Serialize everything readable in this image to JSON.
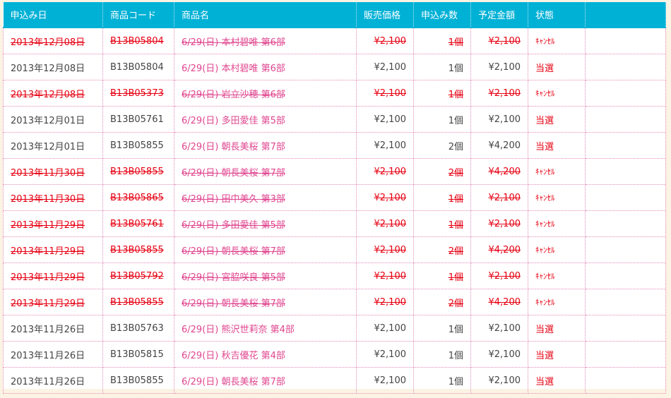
{
  "columns": {
    "date": "申込み日",
    "code": "商品コード",
    "name": "商品名",
    "price": "販売価格",
    "qty": "申込み数",
    "amount": "予定金額",
    "status": "状態"
  },
  "rows": [
    {
      "date": "2013年12月08日",
      "code": "B13B05804",
      "name": "6/29(日) 本村碧唯 第6部",
      "price": "¥2,100",
      "qty": "1個",
      "amount": "¥2,100",
      "status": "ｷｬﾝｾﾙ",
      "cancelled": true
    },
    {
      "date": "2013年12月08日",
      "code": "B13B05804",
      "name": "6/29(日) 本村碧唯 第6部",
      "price": "¥2,100",
      "qty": "1個",
      "amount": "¥2,100",
      "status": "当選",
      "cancelled": false
    },
    {
      "date": "2013年12月08日",
      "code": "B13B05373",
      "name": "6/29(日) 岩立沙穂 第6部",
      "price": "¥2,100",
      "qty": "1個",
      "amount": "¥2,100",
      "status": "ｷｬﾝｾﾙ",
      "cancelled": true
    },
    {
      "date": "2013年12月01日",
      "code": "B13B05761",
      "name": "6/29(日) 多田愛佳 第5部",
      "price": "¥2,100",
      "qty": "1個",
      "amount": "¥2,100",
      "status": "当選",
      "cancelled": false
    },
    {
      "date": "2013年12月01日",
      "code": "B13B05855",
      "name": "6/29(日) 朝長美桜 第7部",
      "price": "¥2,100",
      "qty": "2個",
      "amount": "¥4,200",
      "status": "当選",
      "cancelled": false
    },
    {
      "date": "2013年11月30日",
      "code": "B13B05855",
      "name": "6/29(日) 朝長美桜 第7部",
      "price": "¥2,100",
      "qty": "2個",
      "amount": "¥4,200",
      "status": "ｷｬﾝｾﾙ",
      "cancelled": true
    },
    {
      "date": "2013年11月30日",
      "code": "B13B05865",
      "name": "6/29(日) 田中美久 第3部",
      "price": "¥2,100",
      "qty": "1個",
      "amount": "¥2,100",
      "status": "ｷｬﾝｾﾙ",
      "cancelled": true
    },
    {
      "date": "2013年11月29日",
      "code": "B13B05761",
      "name": "6/29(日) 多田愛佳 第5部",
      "price": "¥2,100",
      "qty": "1個",
      "amount": "¥2,100",
      "status": "ｷｬﾝｾﾙ",
      "cancelled": true
    },
    {
      "date": "2013年11月29日",
      "code": "B13B05855",
      "name": "6/29(日) 朝長美桜 第7部",
      "price": "¥2,100",
      "qty": "2個",
      "amount": "¥4,200",
      "status": "ｷｬﾝｾﾙ",
      "cancelled": true
    },
    {
      "date": "2013年11月29日",
      "code": "B13B05792",
      "name": "6/29(日) 宮脇咲良 第5部",
      "price": "¥2,100",
      "qty": "1個",
      "amount": "¥2,100",
      "status": "ｷｬﾝｾﾙ",
      "cancelled": true
    },
    {
      "date": "2013年11月29日",
      "code": "B13B05855",
      "name": "6/29(日) 朝長美桜 第7部",
      "price": "¥2,100",
      "qty": "2個",
      "amount": "¥4,200",
      "status": "ｷｬﾝｾﾙ",
      "cancelled": true
    },
    {
      "date": "2013年11月26日",
      "code": "B13B05763",
      "name": "6/29(日) 熊沢世莉奈 第4部",
      "price": "¥2,100",
      "qty": "1個",
      "amount": "¥2,100",
      "status": "当選",
      "cancelled": false
    },
    {
      "date": "2013年11月26日",
      "code": "B13B05815",
      "name": "6/29(日) 秋吉優花 第4部",
      "price": "¥2,100",
      "qty": "1個",
      "amount": "¥2,100",
      "status": "当選",
      "cancelled": false
    },
    {
      "date": "2013年11月26日",
      "code": "B13B05855",
      "name": "6/29(日) 朝長美桜 第7部",
      "price": "¥2,100",
      "qty": "1個",
      "amount": "¥2,100",
      "status": "当選",
      "cancelled": false
    }
  ],
  "colors": {
    "header_bg": "#00b1d6",
    "product_text": "#e0468f",
    "status_red": "#e60012",
    "border_dotted": "#e58ab8",
    "page_bg": "#fbf3e4"
  }
}
